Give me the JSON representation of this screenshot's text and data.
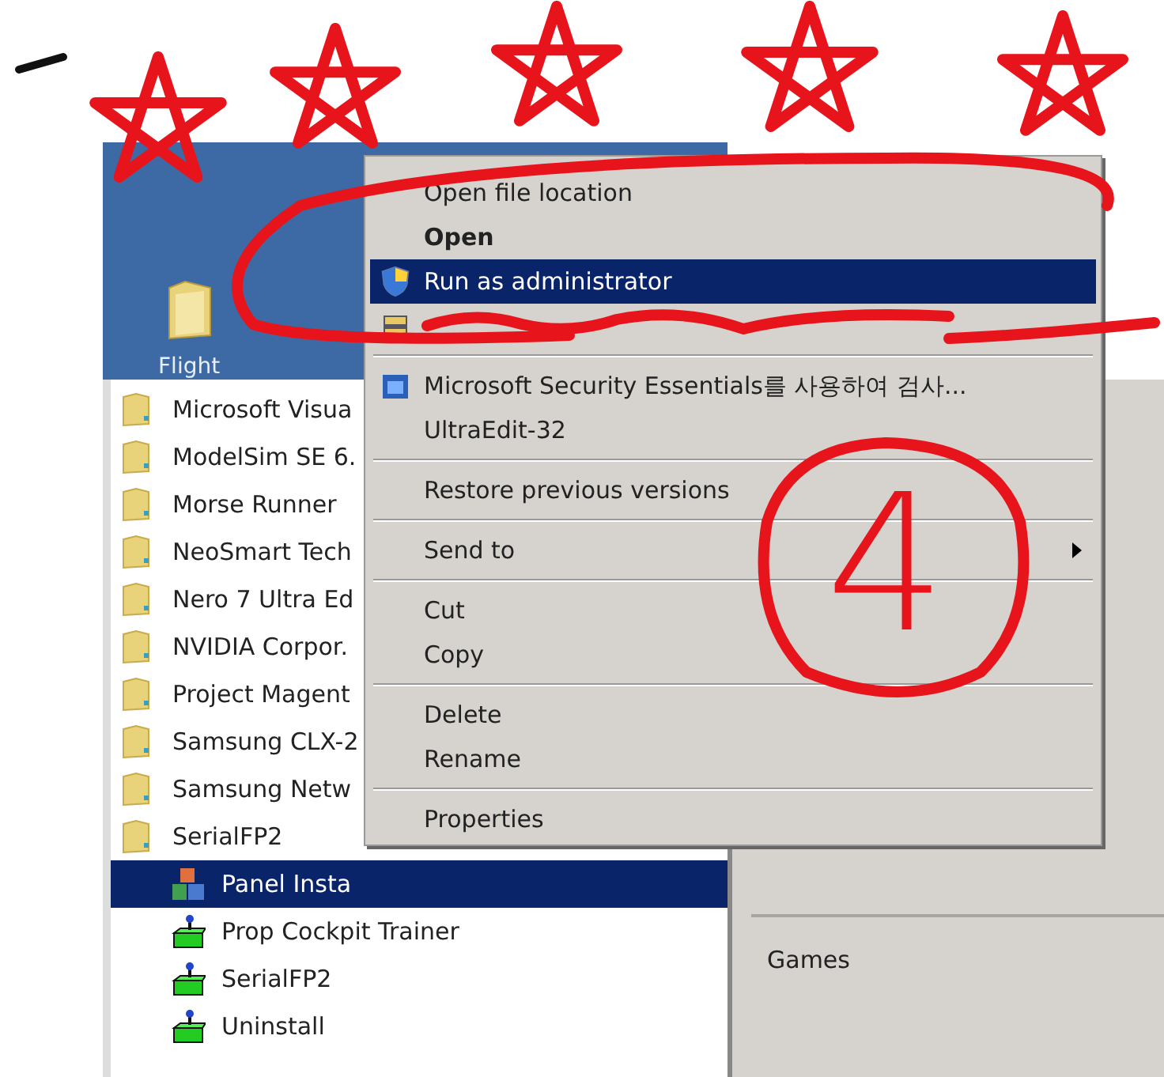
{
  "start_menu": {
    "pinned": [
      {
        "label": "Flight"
      }
    ],
    "programs": [
      {
        "label": "Microsoft Visua",
        "kind": "folder",
        "selected": false
      },
      {
        "label": "ModelSim SE 6.",
        "kind": "folder",
        "selected": false
      },
      {
        "label": "Morse Runner",
        "kind": "folder",
        "selected": false
      },
      {
        "label": "NeoSmart Tech",
        "kind": "folder",
        "selected": false
      },
      {
        "label": "Nero 7 Ultra Ed",
        "kind": "folder",
        "selected": false
      },
      {
        "label": "NVIDIA Corpor.",
        "kind": "folder",
        "selected": false
      },
      {
        "label": "Project Magent",
        "kind": "folder",
        "selected": false
      },
      {
        "label": "Samsung CLX-2",
        "kind": "folder",
        "selected": false
      },
      {
        "label": "Samsung Netw",
        "kind": "folder",
        "selected": false
      },
      {
        "label": "SerialFP2",
        "kind": "folder",
        "selected": false,
        "children": [
          {
            "label": "Panel Insta",
            "kind": "installer",
            "selected": true
          },
          {
            "label": "Prop Cockpit Trainer",
            "kind": "app",
            "selected": false
          },
          {
            "label": "SerialFP2",
            "kind": "app",
            "selected": false
          },
          {
            "label": "Uninstall",
            "kind": "app",
            "selected": false
          }
        ]
      }
    ],
    "right_panel": [
      {
        "label": "Games"
      }
    ]
  },
  "context_menu": [
    {
      "kind": "item",
      "label": "Open file location",
      "selected": false
    },
    {
      "kind": "bold",
      "label": "Open",
      "selected": false
    },
    {
      "kind": "shield",
      "label": "Run as administrator",
      "selected": true
    },
    {
      "kind": "zip",
      "selected": false
    },
    {
      "kind": "separator"
    },
    {
      "kind": "scan",
      "label": "Microsoft Security Essentials를 사용하여 검사...",
      "selected": false
    },
    {
      "kind": "item",
      "label": "UltraEdit-32",
      "selected": false
    },
    {
      "kind": "separator"
    },
    {
      "kind": "item",
      "label": "Restore previous versions",
      "selected": false
    },
    {
      "kind": "separator"
    },
    {
      "kind": "submenu",
      "label": "Send to",
      "selected": false
    },
    {
      "kind": "separator"
    },
    {
      "kind": "item",
      "label": "Cut",
      "selected": false
    },
    {
      "kind": "item",
      "label": "Copy",
      "selected": false
    },
    {
      "kind": "separator"
    },
    {
      "kind": "item",
      "label": "Delete",
      "selected": false
    },
    {
      "kind": "item",
      "label": "Rename",
      "selected": false
    },
    {
      "kind": "separator"
    },
    {
      "kind": "item",
      "label": "Properties",
      "selected": false
    }
  ],
  "annotation": {
    "number": "4"
  }
}
